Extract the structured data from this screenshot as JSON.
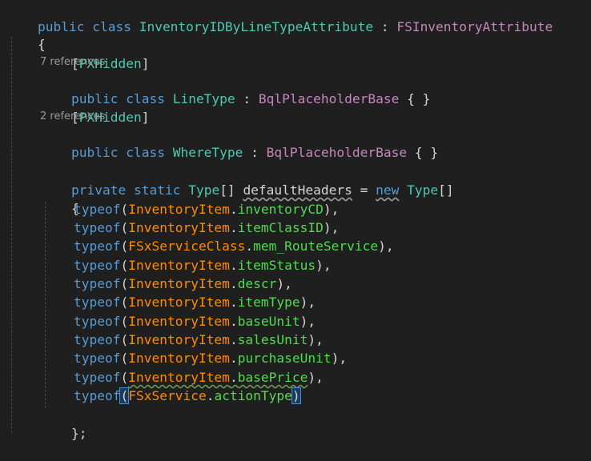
{
  "colors": {
    "background": "#1f1f1f",
    "keyword": "#569cd6",
    "type": "#4ec9b0",
    "class_name": "#c586c0",
    "attribute": "#4ec9b0",
    "orange_type": "#ff8c00",
    "member": "#4fdc4f",
    "punct": "#d4d4d4",
    "codelens": "#999999"
  },
  "editor": {
    "line1": {
      "kw1": "public",
      "kw2": "class",
      "name": "InventoryIDByLineTypeAttribute",
      "colon": " : ",
      "base": "FSInventoryAttribute"
    },
    "open_brace": "{",
    "attr1": {
      "open": "[",
      "name": "PXHidden",
      "close": "]"
    },
    "lens1": "7 references",
    "line_linetype": {
      "kw1": "public",
      "kw2": "class",
      "name": "LineType",
      "colon": " : ",
      "base": "BqlPlaceholderBase",
      "body": " { }"
    },
    "attr2": {
      "open": "[",
      "name": "PXHidden",
      "close": "]"
    },
    "lens2": "2 references",
    "line_wheretype": {
      "kw1": "public",
      "kw2": "class",
      "name": "WhereType",
      "colon": " : ",
      "base": "BqlPlaceholderBase",
      "body": " { }"
    },
    "line_field": {
      "kw1": "private",
      "kw2": "static",
      "type": "Type",
      "arr": "[] ",
      "var": "defaultHeaders",
      "eq": " = ",
      "new": "new",
      "type2": "Type",
      "arr2": "[]"
    },
    "inner_open": "{",
    "typeof_kw": "typeof",
    "entries": [
      {
        "cls": "InventoryItem",
        "member": "inventoryCD",
        "end": "),"
      },
      {
        "cls": "InventoryItem",
        "member": "itemClassID",
        "end": "),"
      },
      {
        "cls": "FSxServiceClass",
        "member": "mem_RouteService",
        "end": "),"
      },
      {
        "cls": "InventoryItem",
        "member": "itemStatus",
        "end": "),"
      },
      {
        "cls": "InventoryItem",
        "member": "descr",
        "end": "),"
      },
      {
        "cls": "InventoryItem",
        "member": "itemType",
        "end": "),"
      },
      {
        "cls": "InventoryItem",
        "member": "baseUnit",
        "end": "),"
      },
      {
        "cls": "InventoryItem",
        "member": "salesUnit",
        "end": "),"
      },
      {
        "cls": "InventoryItem",
        "member": "purchaseUnit",
        "end": "),"
      },
      {
        "cls": "InventoryItem",
        "member": "basePrice",
        "end": "),"
      },
      {
        "cls": "FSxService",
        "member": "actionType",
        "end": ")"
      }
    ],
    "inner_close": "};"
  }
}
